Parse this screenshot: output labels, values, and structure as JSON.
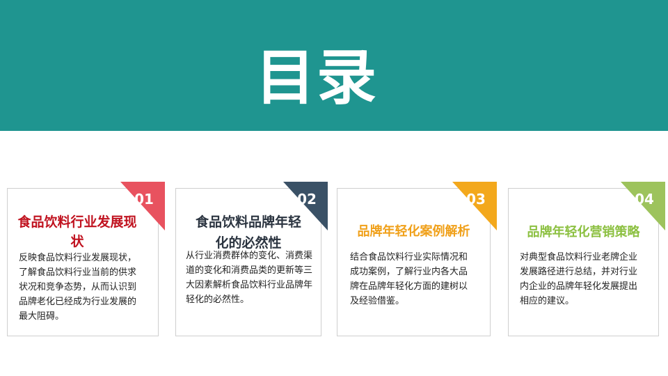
{
  "slide": {
    "title": "目录",
    "colors": {
      "banner": "#1f9590",
      "card_border": "#cfcfcf"
    }
  },
  "cards": [
    {
      "number": "01",
      "title": "食品饮料行业发展现状",
      "description": "反映食品饮料行业发展现状，了解食品饮料行业当前的供求状况和竞争态势，从而认识到品牌老化已经成为行业发展的最大阻碍。",
      "accent": "#e8525f",
      "title_color": "#c0121f"
    },
    {
      "number": "02",
      "title": "食品饮料品牌年轻化的必然性",
      "description": "从行业消费群体的变化、消费渠道的变化和消费品类的更新等三大因素解析食品饮料行业品牌年轻化的必然性。",
      "accent": "#3a5166",
      "title_color": "#2b3440"
    },
    {
      "number": "03",
      "title": "品牌年轻化案例解析",
      "description": "结合食品饮料行业实际情况和成功案例，了解行业内各大品牌在品牌年轻化方面的建树以及经验借鉴。",
      "accent": "#f3a81c",
      "title_color": "#f0a019"
    },
    {
      "number": "04",
      "title": "品牌年轻化营销策略",
      "description": "对典型食品饮料行业老牌企业发展路径进行总结，并对行业内企业的品牌年轻化发展提出相应的建议。",
      "accent": "#9dc35c",
      "title_color": "#8cc041"
    }
  ]
}
